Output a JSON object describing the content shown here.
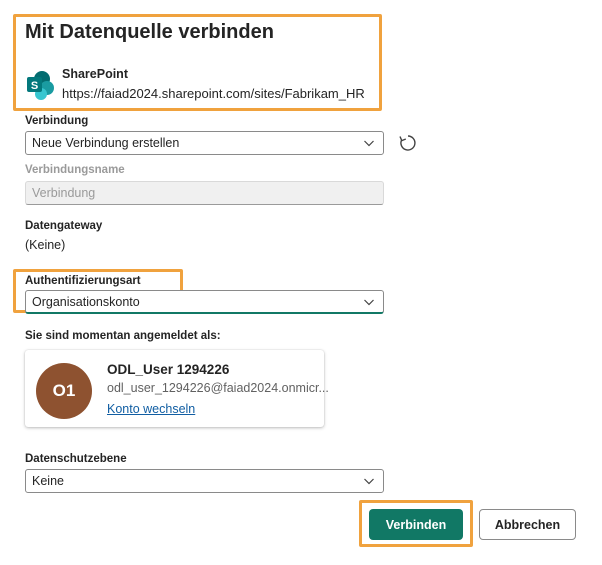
{
  "dialog": {
    "title": "Mit Datenquelle verbinden",
    "source_name": "SharePoint",
    "source_url": "https://faiad2024.sharepoint.com/sites/Fabrikam_HR"
  },
  "connection": {
    "label": "Verbindung",
    "selected": "Neue Verbindung erstellen",
    "name_label": "Verbindungsname",
    "name_value": "Verbindung"
  },
  "gateway": {
    "label": "Datengateway",
    "value": "(Keine)"
  },
  "auth": {
    "label": "Authentifizierungsart",
    "selected": "Organisationskonto"
  },
  "account": {
    "signed_in_label": "Sie sind momentan angemeldet als:",
    "initials": "O1",
    "avatar_color": "#8e5230",
    "display_name": "ODL_User 1294226",
    "email": "odl_user_1294226@faiad2024.onmicr...",
    "switch_link": "Konto wechseln"
  },
  "privacy": {
    "label": "Datenschutzebene",
    "selected": "Keine"
  },
  "buttons": {
    "connect": "Verbinden",
    "cancel": "Abbrechen"
  },
  "colors": {
    "primary": "#117865",
    "highlight": "#f0a23e",
    "link": "#115ea3"
  }
}
